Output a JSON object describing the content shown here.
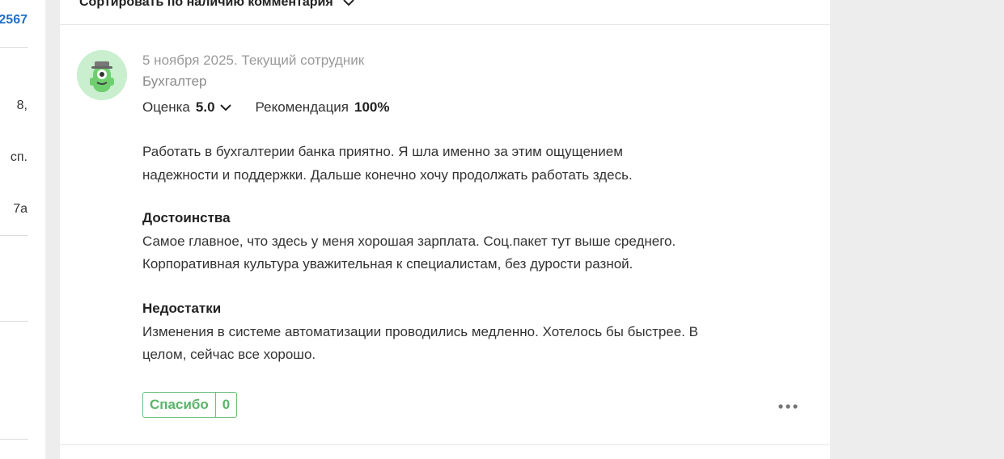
{
  "left_column": {
    "link_text": "2567",
    "line1": "8,",
    "line2": "сп.",
    "line3": "7а"
  },
  "sort": {
    "label": "Сортировать по наличию комментария"
  },
  "review": {
    "date_status": "5 ноября 2025. Текущий сотрудник",
    "position": "Бухгалтер",
    "rating_label": "Оценка",
    "rating_value": "5.0",
    "recommendation_label": "Рекомендация",
    "recommendation_value": "100%",
    "body_line1": "Работать в бухгалтерии банка приятно. Я шла именно за этим ощущением",
    "body_line2": "надежности и поддержки. Дальше конечно хочу продолжать работать здесь.",
    "pros_heading": "Достоинства",
    "pros_line1": "Самое главное, что здесь у меня хорошая зарплата. Соц.пакет тут выше среднего.",
    "pros_line2": "Корпоративная культура уважительная к специалистам, без дурости разной.",
    "cons_heading": "Недостатки",
    "cons_line1": "Изменения в системе автоматизации проводились медленно. Хотелось бы быстрее. В",
    "cons_line2": "целом, сейчас все хорошо.",
    "thanks_label": "Спасибо",
    "thanks_count": "0"
  },
  "colors": {
    "accent_green": "#5bb56b",
    "link_blue": "#1f6fc8",
    "avatar_bg": "#c9efcf"
  },
  "icons": {
    "sort": "chevron-down-icon",
    "rating": "chevron-down-icon",
    "avatar": "monster-avatar-icon",
    "more": "more-dots-icon"
  }
}
